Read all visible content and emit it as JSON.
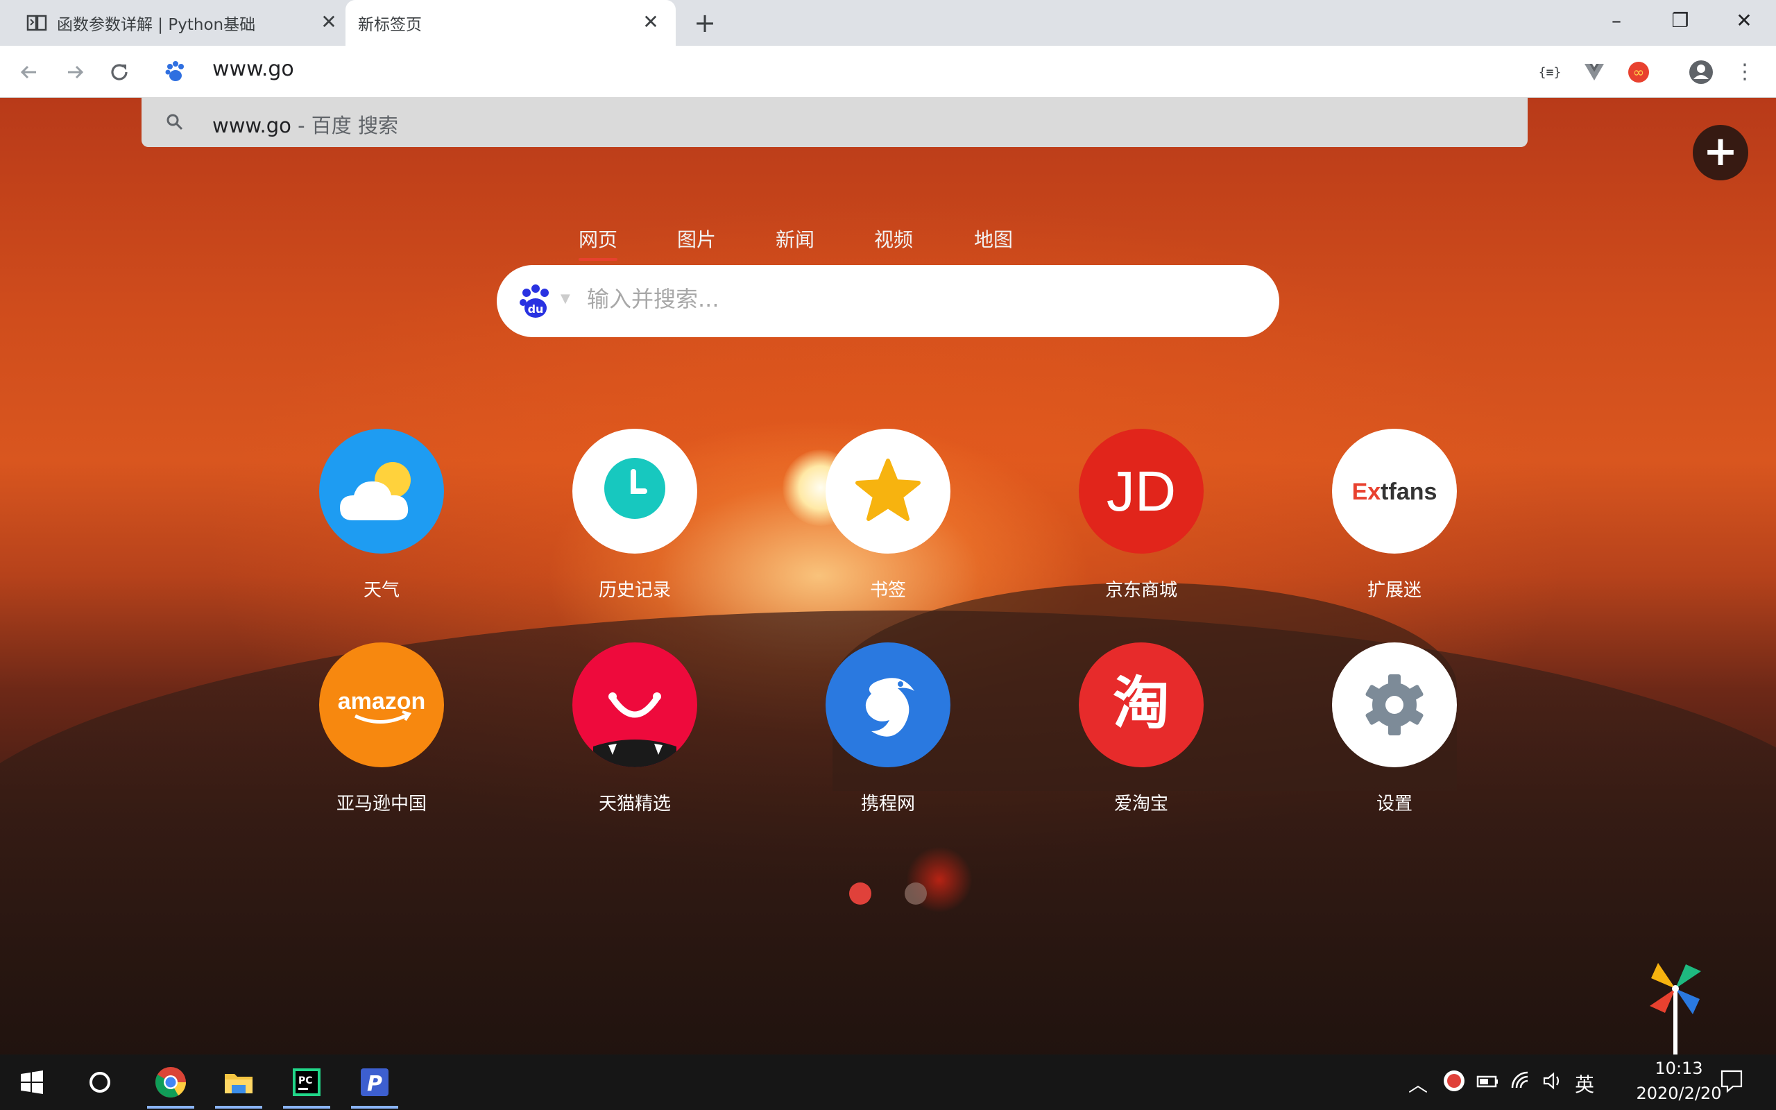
{
  "browser": {
    "tabs": [
      {
        "title": "函数参数详解 | Python基础",
        "icon": "book-icon",
        "active": false
      },
      {
        "title": "新标签页",
        "icon": "",
        "active": true
      }
    ],
    "new_tab_label": "+",
    "window_controls": {
      "minimize": "–",
      "restore": "❐",
      "close": "✕"
    },
    "omnibox": {
      "value": "www.go",
      "engine_icon": "baidu-paw-icon"
    },
    "suggestion": {
      "query": "www.go",
      "description": " - 百度 搜索",
      "icon": "search-icon"
    },
    "extensions": [
      "json-formatter-icon",
      "vue-devtools-icon",
      "infinity-icon",
      "profile-icon",
      "menu-icon"
    ]
  },
  "newtab": {
    "search_tabs": [
      "网页",
      "图片",
      "新闻",
      "视频",
      "地图"
    ],
    "active_search_tab": 0,
    "search_placeholder": "输入并搜索...",
    "tiles": [
      {
        "label": "天气",
        "icon": "weather-icon"
      },
      {
        "label": "历史记录",
        "icon": "clock-icon"
      },
      {
        "label": "书签",
        "icon": "star-icon"
      },
      {
        "label": "京东商城",
        "icon": "jd-logo",
        "logo_text": "JD"
      },
      {
        "label": "扩展迷",
        "icon": "extfans-logo",
        "logo_text_red": "Ex",
        "logo_text_dark": "tfans"
      },
      {
        "label": "亚马逊中国",
        "icon": "amazon-logo",
        "logo_text": "amazon"
      },
      {
        "label": "天猫精选",
        "icon": "tmall-icon"
      },
      {
        "label": "携程网",
        "icon": "ctrip-dolphin-icon"
      },
      {
        "label": "爱淘宝",
        "icon": "taobao-logo",
        "logo_text": "淘"
      },
      {
        "label": "设置",
        "icon": "gear-icon"
      }
    ],
    "page_dots": {
      "count": 2,
      "active": 0
    },
    "colors": {
      "active_dot": "#e0413a",
      "inactive_dot": "rgba(140,110,100,0.75)",
      "accent": "#e8412f"
    }
  },
  "taskbar": {
    "apps": [
      "windows-start-icon",
      "cortana-icon",
      "chrome-icon",
      "file-explorer-icon",
      "pycharm-icon",
      "p-app-icon"
    ],
    "tray": {
      "ime": "英"
    },
    "clock": {
      "time": "10:13",
      "date": "2020/2/20"
    }
  }
}
